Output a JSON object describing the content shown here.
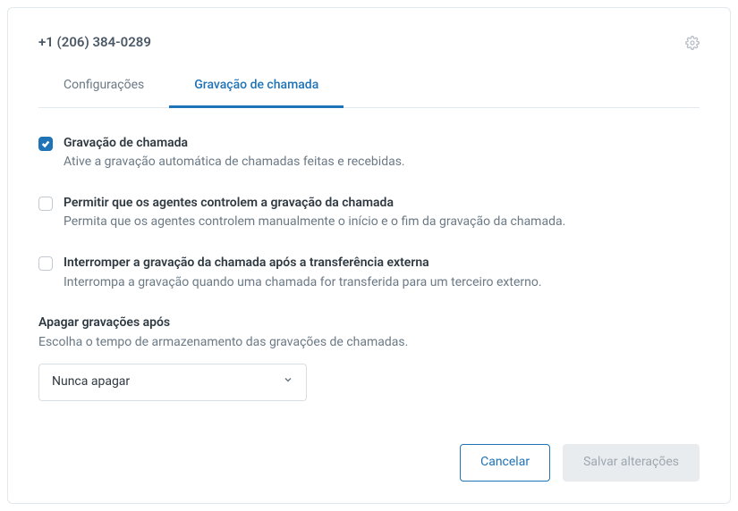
{
  "header": {
    "phone": "+1 (206) 384-0289"
  },
  "tabs": {
    "settings": "Configurações",
    "recording": "Gravação de chamada"
  },
  "options": {
    "record": {
      "title": "Gravação de chamada",
      "desc": "Ative a gravação automática de chamadas feitas e recebidas."
    },
    "agents": {
      "title": "Permitir que os agentes controlem a gravação da chamada",
      "desc": "Permita que os agentes controlem manualmente o início e o fim da gravação da chamada."
    },
    "stop": {
      "title": "Interromper a gravação da chamada após a transferência externa",
      "desc": "Interrompa a gravação quando uma chamada for transferida para um terceiro externo."
    }
  },
  "retention": {
    "title": "Apagar gravações após",
    "desc": "Escolha o tempo de armazenamento das gravações de chamadas.",
    "selected": "Nunca apagar"
  },
  "footer": {
    "cancel": "Cancelar",
    "save": "Salvar alterações"
  }
}
